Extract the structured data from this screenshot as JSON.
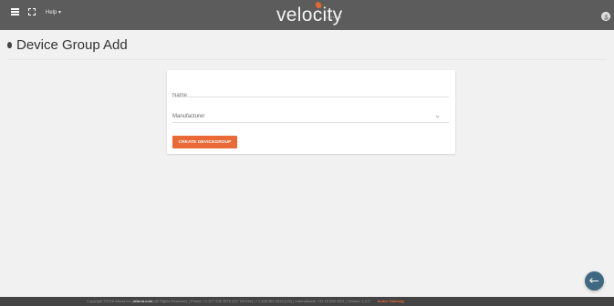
{
  "header": {
    "help_label": "Help ▾",
    "logo_text": "velocity",
    "logo_sub": "by ATLONA"
  },
  "page": {
    "title": "Device Group Add"
  },
  "form": {
    "name_placeholder": "Name",
    "name_value": "",
    "manufacturer_label": "Manufacturer",
    "create_button_label": "CREATE DEVICEGROUP"
  },
  "footer": {
    "copyright_prefix": "Copyright ©2018 Atlona Inc (",
    "link_text": "atlona.com",
    "copyright_suffix": ") All Rights Reserved. | Phone: +1 877 536 3976 (US Toll free) | +1 408 962 0515 (US) | International: +41 43 508 4321 | Version: 1.4.3",
    "gateway_label": "Active Gateway"
  },
  "colors": {
    "topbar": "#5c5c5c",
    "accent": "#e96a36",
    "fab": "#3f6980",
    "footer": "#444444"
  }
}
